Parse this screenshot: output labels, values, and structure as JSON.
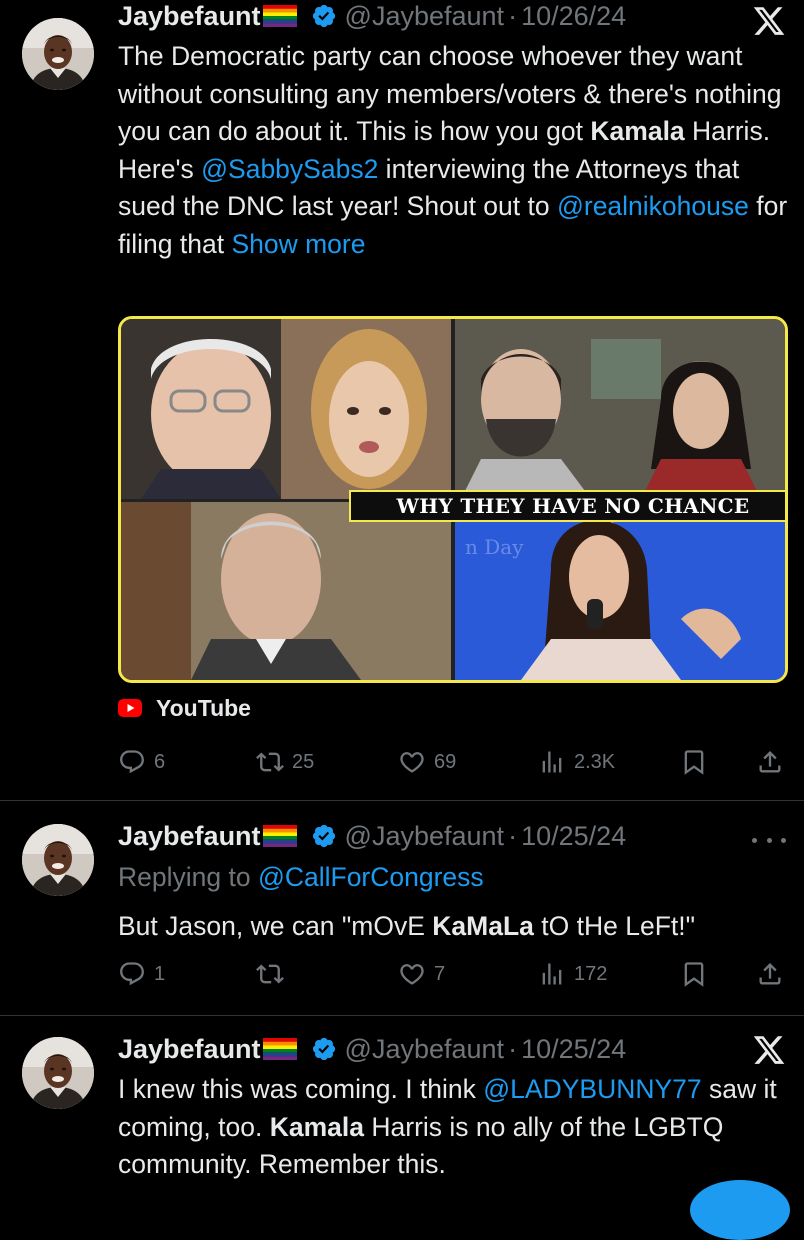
{
  "tweets": [
    {
      "name": "Jaybefaunt",
      "handle": "@Jaybefaunt",
      "dot": "·",
      "date": "10/26/24",
      "body": {
        "p1": "The Democratic party can choose whoever they want without consulting any members/voters & there's nothing you can do about it. This is how you got ",
        "bold1": "Kamala",
        "p2": " Harris. Here's ",
        "mention1": "@SabbySabs2",
        "p3": " interviewing the Attorneys that sued the DNC last year! Shout out to ",
        "mention2": "@realnikohouse",
        "p4": " for filing that ",
        "show_more": "Show more"
      },
      "media": {
        "banner": "WHY THEY HAVE NO CHANCE",
        "bg_text": "n Day"
      },
      "source": "YouTube",
      "stats": {
        "replies": "6",
        "retweets": "25",
        "likes": "69",
        "views": "2.3K"
      }
    },
    {
      "name": "Jaybefaunt",
      "handle": "@Jaybefaunt",
      "dot": "·",
      "date": "10/25/24",
      "replying_prefix": "Replying to ",
      "replying_to": "@CallForCongress",
      "body": {
        "p1": "But Jason, we can \"mOvE ",
        "bold1": "KaMaLa",
        "p2": " tO tHe LeFt!\""
      },
      "stats": {
        "replies": "1",
        "retweets": "",
        "likes": "7",
        "views": "172"
      }
    },
    {
      "name": "Jaybefaunt",
      "handle": "@Jaybefaunt",
      "dot": "·",
      "date": "10/25/24",
      "body": {
        "p1": "I knew this was coming. I think ",
        "mention1": "@LADYBUNNY77",
        "p2": " saw it coming, too. ",
        "bold1": "Kamala",
        "p3": " Harris is no ally of the LGBTQ community. Remember this."
      }
    }
  ],
  "colors": {
    "accent": "#1d9bf0",
    "muted": "#71767b",
    "text": "#e7e9ea",
    "bg": "#000000",
    "media_border": "#f5e84b"
  },
  "icons": [
    "x-logo-icon",
    "verified-badge-icon",
    "rainbow-flag-icon",
    "reply-icon",
    "retweet-icon",
    "like-icon",
    "views-icon",
    "bookmark-icon",
    "share-icon",
    "more-icon",
    "youtube-icon"
  ]
}
